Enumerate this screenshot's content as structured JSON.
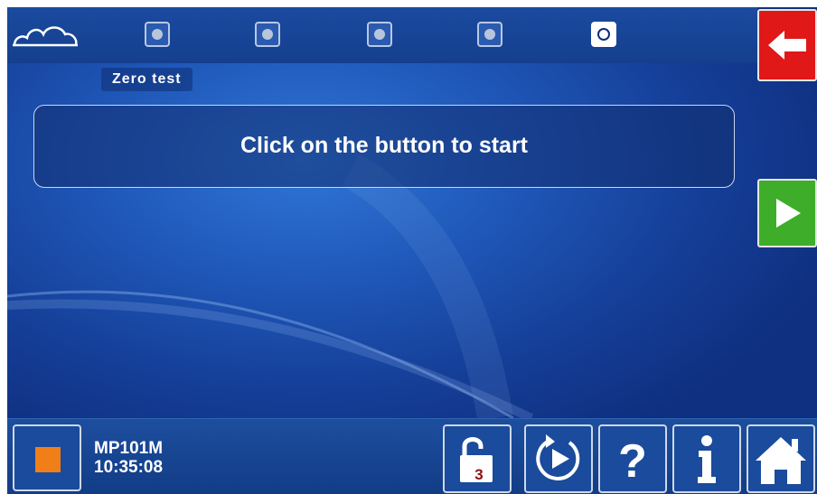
{
  "header": {
    "logo_icon": "cloud-icon",
    "steps": [
      {
        "state": "inactive"
      },
      {
        "state": "inactive"
      },
      {
        "state": "inactive"
      },
      {
        "state": "inactive"
      },
      {
        "state": "active"
      }
    ]
  },
  "section": {
    "tab_label": "Zero test"
  },
  "message": {
    "text": "Click on the button to start"
  },
  "side": {
    "back_icon": "arrow-left-icon",
    "next_icon": "play-icon"
  },
  "status": {
    "device": "MP101M",
    "time": "10:35:08"
  },
  "toolbar": {
    "stop_icon": "stop-icon",
    "lock_level": "3",
    "buttons": [
      "unlock-icon",
      "replay-icon",
      "help-icon",
      "info-icon",
      "home-icon"
    ]
  },
  "colors": {
    "back": "#e01818",
    "next": "#3eae2a",
    "stop": "#f07f18",
    "background": "#1f57b8"
  }
}
